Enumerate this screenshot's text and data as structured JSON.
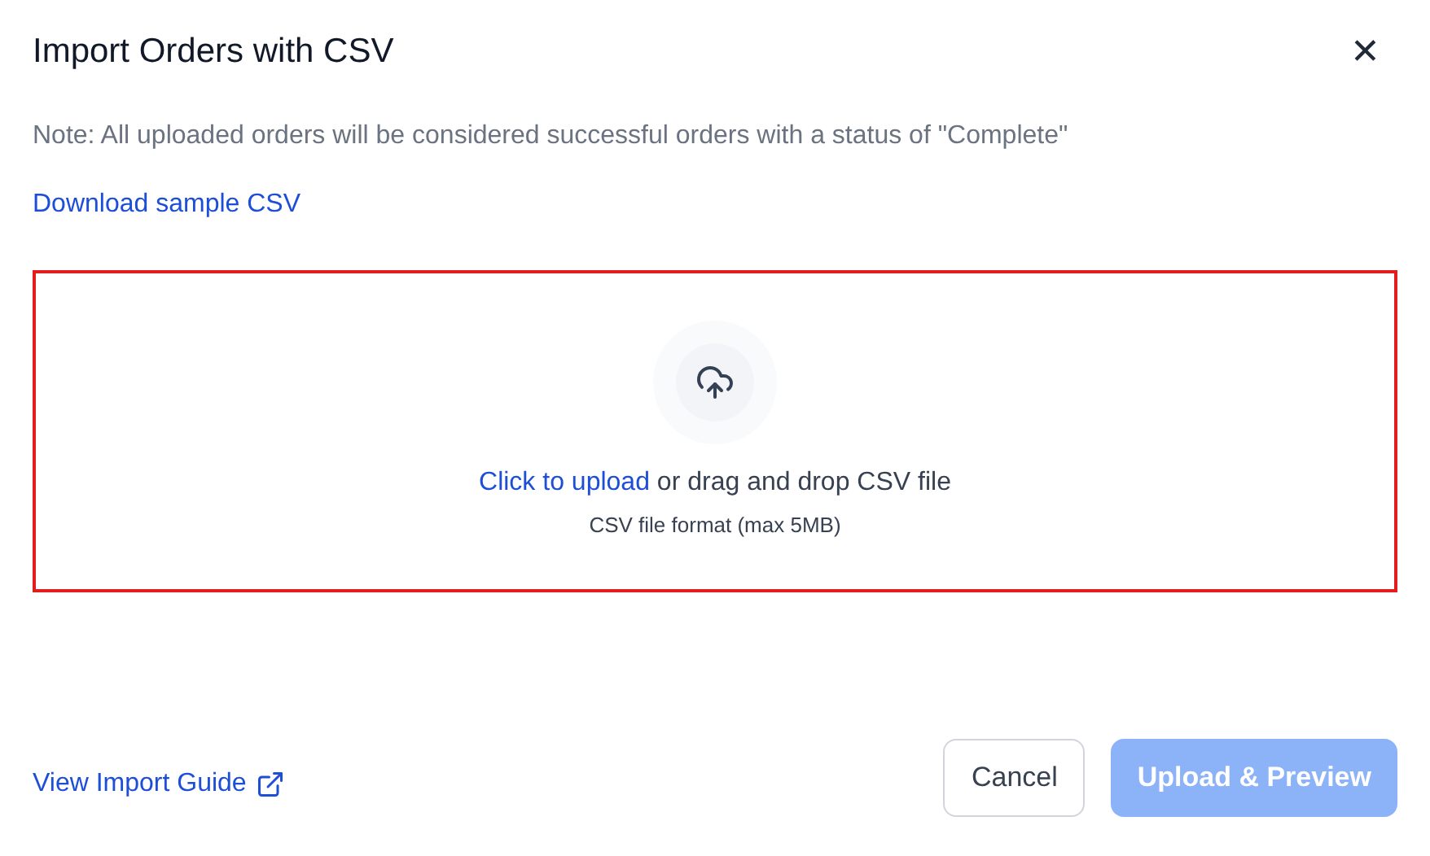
{
  "dialog": {
    "title": "Import Orders with CSV",
    "close_label": "✕"
  },
  "note": "Note: All uploaded orders will be considered successful orders with a status of \"Complete\"",
  "download_link": "Download sample CSV",
  "dropzone": {
    "highlighted": true,
    "link": "Click to upload",
    "text": "or drag and drop CSV file",
    "hint": "CSV file format (max 5MB)"
  },
  "footer": {
    "guide_link": "View Import Guide",
    "buttons": [
      {
        "label": "Cancel",
        "kind": "secondary",
        "disabled": false
      },
      {
        "label": "Upload & Preview",
        "kind": "primary",
        "disabled": true
      }
    ]
  }
}
